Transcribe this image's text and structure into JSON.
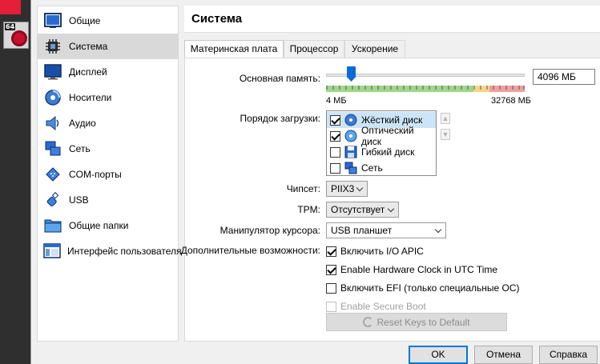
{
  "parent_window": {
    "vm_badge": "64"
  },
  "sidebar": {
    "items": [
      {
        "label": "Общие",
        "icon": "general-icon"
      },
      {
        "label": "Система",
        "icon": "system-icon",
        "selected": true
      },
      {
        "label": "Дисплей",
        "icon": "display-icon"
      },
      {
        "label": "Носители",
        "icon": "storage-icon"
      },
      {
        "label": "Аудио",
        "icon": "audio-icon"
      },
      {
        "label": "Сеть",
        "icon": "network-icon"
      },
      {
        "label": "COM-порты",
        "icon": "serial-ports-icon"
      },
      {
        "label": "USB",
        "icon": "usb-icon"
      },
      {
        "label": "Общие папки",
        "icon": "shared-folders-icon"
      },
      {
        "label": "Интерфейс пользователя",
        "icon": "user-interface-icon"
      }
    ]
  },
  "page": {
    "title": "Система"
  },
  "tabs": [
    {
      "label": "Материнская плата",
      "active": true
    },
    {
      "label": "Процессор"
    },
    {
      "label": "Ускорение"
    }
  ],
  "motherboard": {
    "memory_label": "Основная память:",
    "memory_value": "4096 МБ",
    "memory_fraction": 0.125,
    "memory_min_label": "4 МБ",
    "memory_max_label": "32768 МБ",
    "boot_order_label": "Порядок загрузки:",
    "boot_order": [
      {
        "label": "Жёсткий диск",
        "checked": true,
        "selected": true,
        "icon": "hard-disk-icon"
      },
      {
        "label": "Оптический диск",
        "checked": true,
        "icon": "optical-disk-icon"
      },
      {
        "label": "Гибкий диск",
        "checked": false,
        "icon": "floppy-disk-icon"
      },
      {
        "label": "Сеть",
        "checked": false,
        "icon": "network-boot-icon"
      }
    ],
    "chipset_label": "Чипсет:",
    "chipset_value": "PIIX3",
    "tpm_label": "TPM:",
    "tpm_value": "Отсутствует",
    "pointing_label": "Манипулятор курсора:",
    "pointing_value": "USB планшет",
    "extended_label": "Дополнительные возможности:",
    "options": [
      {
        "label": "Включить I/O APIC",
        "checked": true,
        "enabled": true
      },
      {
        "label": "Enable Hardware Clock in UTC Time",
        "checked": true,
        "enabled": true
      },
      {
        "label": "Включить EFI (только специальные ОС)",
        "checked": false,
        "enabled": true
      },
      {
        "label": "Enable Secure Boot",
        "checked": false,
        "enabled": false
      }
    ],
    "reset_keys_label": "Reset Keys to Default"
  },
  "buttons": {
    "ok": "OK",
    "cancel": "Отмена",
    "help": "Справка"
  },
  "colors": {
    "accent": "#0078d7",
    "slider_handle": "#0a6cd6",
    "scale_green": "#9ed68a",
    "scale_red": "#f0a0a0"
  }
}
